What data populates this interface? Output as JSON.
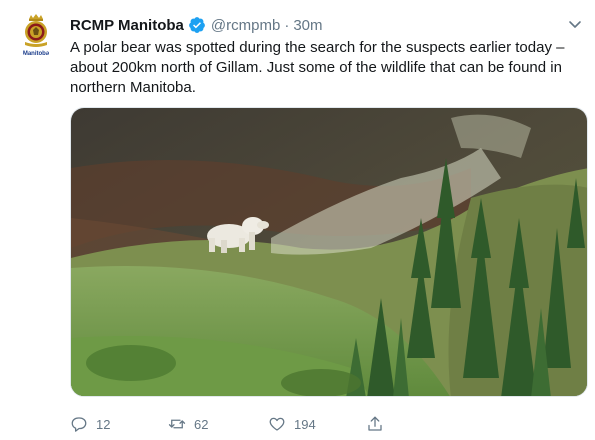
{
  "colors": {
    "accent": "#1da1f2",
    "text": "#14171a",
    "secondary": "#657786"
  },
  "tweet": {
    "author": {
      "display_name": "RCMP Manitoba",
      "handle": "@rcmpmb",
      "avatar_caption": "Manitoba",
      "verified_icon": "verified-badge-icon"
    },
    "separator": "·",
    "timestamp": "30m",
    "text": "A polar bear was spotted during the search for the suspects earlier today – about 200km north of Gillam. Just some of the wildlife that can be found in northern Manitoba.",
    "media": {
      "icon": "photo-polar-bear"
    },
    "actions": {
      "reply": {
        "icon": "reply-icon",
        "count": "12"
      },
      "retweet": {
        "icon": "retweet-icon",
        "count": "62"
      },
      "like": {
        "icon": "heart-icon",
        "count": "194"
      },
      "share": {
        "icon": "share-icon"
      }
    },
    "menu_icon": "chevron-down-icon"
  }
}
